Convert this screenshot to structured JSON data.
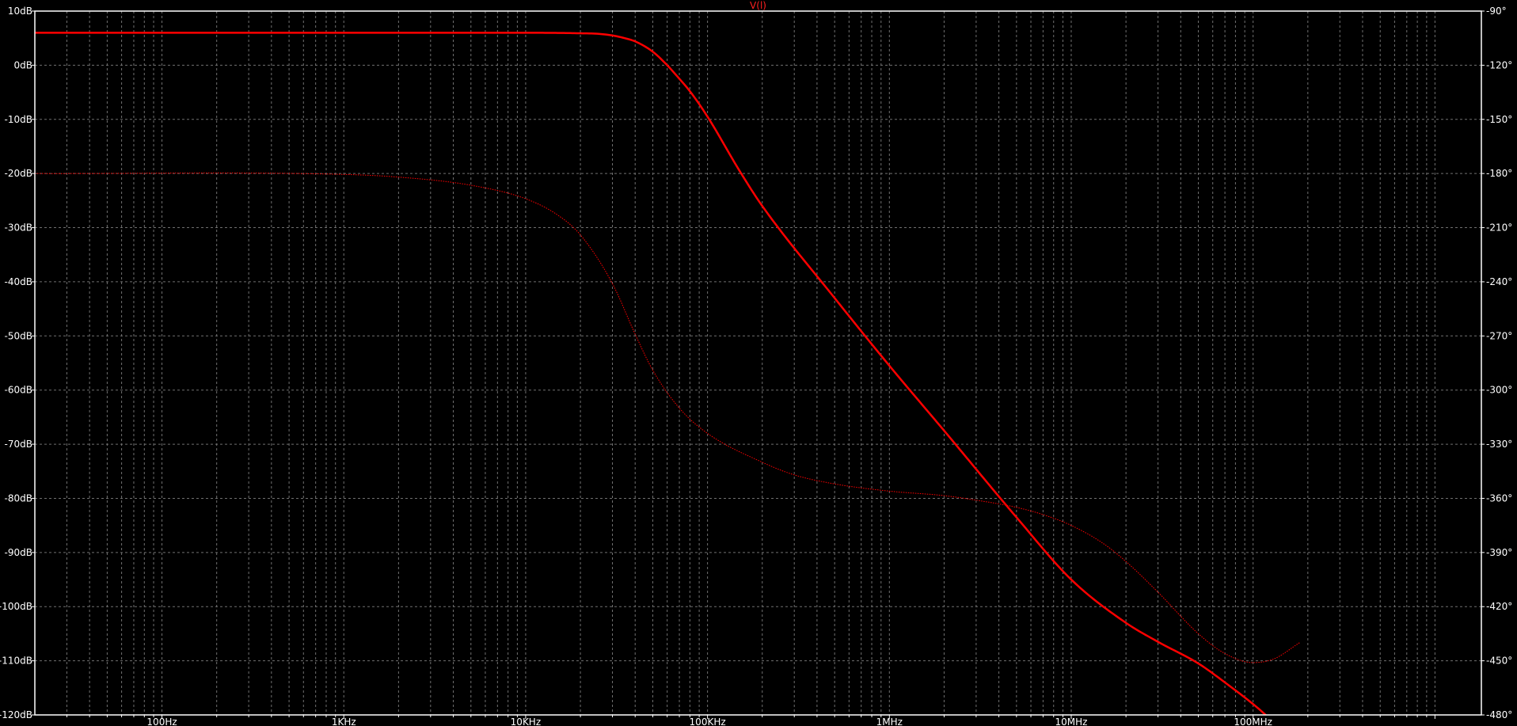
{
  "chart_data": {
    "type": "line",
    "title": "V(l)",
    "x_scale": "log",
    "xlim": [
      20,
      1800000000
    ],
    "x_ticks": [
      {
        "value": 100,
        "label": "100Hz"
      },
      {
        "value": 1000,
        "label": "1KHz"
      },
      {
        "value": 10000,
        "label": "10KHz"
      },
      {
        "value": 100000,
        "label": "100KHz"
      },
      {
        "value": 1000000,
        "label": "1MHz"
      },
      {
        "value": 10000000,
        "label": "10MHz"
      },
      {
        "value": 100000000,
        "label": "100MHz"
      }
    ],
    "y_left": {
      "lim": [
        -120,
        10
      ],
      "ticks": [
        {
          "value": 10,
          "label": "10dB"
        },
        {
          "value": 0,
          "label": "0dB"
        },
        {
          "value": -10,
          "label": "-10dB"
        },
        {
          "value": -20,
          "label": "-20dB"
        },
        {
          "value": -30,
          "label": "-30dB"
        },
        {
          "value": -40,
          "label": "-40dB"
        },
        {
          "value": -50,
          "label": "-50dB"
        },
        {
          "value": -60,
          "label": "-60dB"
        },
        {
          "value": -70,
          "label": "-70dB"
        },
        {
          "value": -80,
          "label": "-80dB"
        },
        {
          "value": -90,
          "label": "-90dB"
        },
        {
          "value": -100,
          "label": "-100dB"
        },
        {
          "value": -110,
          "label": "-110dB"
        },
        {
          "value": -120,
          "label": "-120dB"
        }
      ]
    },
    "y_right": {
      "lim": [
        -480,
        -90
      ],
      "ticks": [
        {
          "value": -90,
          "label": "-90°"
        },
        {
          "value": -120,
          "label": "-120°"
        },
        {
          "value": -150,
          "label": "-150°"
        },
        {
          "value": -180,
          "label": "-180°"
        },
        {
          "value": -210,
          "label": "-210°"
        },
        {
          "value": -240,
          "label": "-240°"
        },
        {
          "value": -270,
          "label": "-270°"
        },
        {
          "value": -300,
          "label": "-300°"
        },
        {
          "value": -330,
          "label": "-330°"
        },
        {
          "value": -360,
          "label": "-360°"
        },
        {
          "value": -390,
          "label": "-390°"
        },
        {
          "value": -420,
          "label": "-420°"
        },
        {
          "value": -450,
          "label": "-450°"
        },
        {
          "value": -480,
          "label": "-480°"
        }
      ]
    },
    "grid": true,
    "colors": {
      "background": "#000000",
      "axes": "#ffffff",
      "grid": "#707070",
      "trace": "#ff0000",
      "title": "#ff2020"
    },
    "series": [
      {
        "role": "magnitude",
        "axis": "left",
        "style": "solid",
        "points": [
          [
            20,
            6
          ],
          [
            1000,
            6
          ],
          [
            10000,
            6
          ],
          [
            20000,
            5.9
          ],
          [
            25000,
            5.8
          ],
          [
            30000,
            5.5
          ],
          [
            35000,
            5
          ],
          [
            40000,
            4.4
          ],
          [
            50000,
            2.5
          ],
          [
            60000,
            0
          ],
          [
            70000,
            -2.5
          ],
          [
            80000,
            -4.8
          ],
          [
            100000,
            -9.5
          ],
          [
            150000,
            -19.5
          ],
          [
            200000,
            -26
          ],
          [
            500000,
            -43
          ],
          [
            1000000,
            -55.5
          ],
          [
            2000000,
            -67.5
          ],
          [
            5000000,
            -83.5
          ],
          [
            10000000,
            -95
          ],
          [
            20000000,
            -103
          ],
          [
            30000000,
            -106.5
          ],
          [
            50000000,
            -110.5
          ],
          [
            70000000,
            -114
          ],
          [
            100000000,
            -118
          ],
          [
            150000000,
            -123
          ],
          [
            180000000,
            -124.5
          ]
        ]
      },
      {
        "role": "phase",
        "axis": "right",
        "style": "dotted",
        "points": [
          [
            20,
            -180
          ],
          [
            1000,
            -180.5
          ],
          [
            2000,
            -182
          ],
          [
            5000,
            -186.5
          ],
          [
            10000,
            -194
          ],
          [
            15000,
            -203
          ],
          [
            20000,
            -214
          ],
          [
            30000,
            -241
          ],
          [
            40000,
            -269
          ],
          [
            50000,
            -289
          ],
          [
            70000,
            -310
          ],
          [
            100000,
            -324
          ],
          [
            200000,
            -340
          ],
          [
            300000,
            -347
          ],
          [
            500000,
            -352
          ],
          [
            1000000,
            -356
          ],
          [
            2000000,
            -358.5
          ],
          [
            3000000,
            -361
          ],
          [
            5000000,
            -365
          ],
          [
            7000000,
            -369
          ],
          [
            10000000,
            -375
          ],
          [
            15000000,
            -385
          ],
          [
            20000000,
            -395
          ],
          [
            30000000,
            -412
          ],
          [
            50000000,
            -435
          ],
          [
            70000000,
            -446
          ],
          [
            100000000,
            -451
          ],
          [
            130000000,
            -449
          ],
          [
            180000000,
            -440
          ]
        ]
      }
    ]
  }
}
